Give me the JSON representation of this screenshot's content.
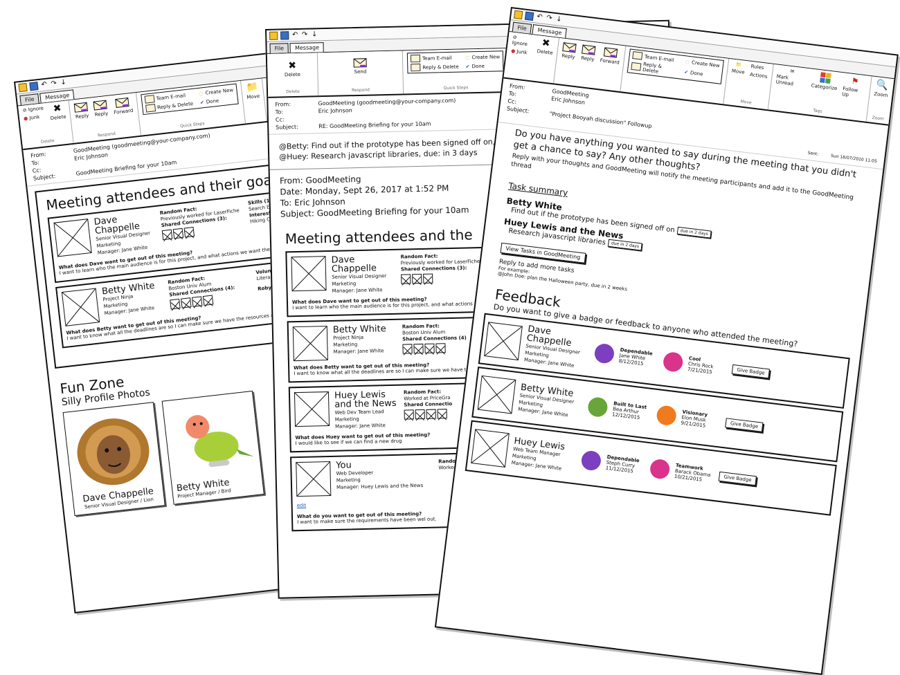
{
  "left": {
    "tabs": [
      "File",
      "Message"
    ],
    "ribbon": {
      "delete_group": {
        "ignore": "Ignore",
        "junk": "Junk",
        "delete": "Delete",
        "caption": "Delete"
      },
      "respond_group": {
        "reply": "Reply",
        "reply_all": "Reply",
        "forward": "Forward",
        "caption": "Respond"
      },
      "quick_steps": {
        "team_email": "Team E-mail",
        "create_new": "Create New",
        "reply_delete": "Reply & Delete",
        "done": "Done",
        "caption": "Quick Steps"
      },
      "move": "Move"
    },
    "header": {
      "from_label": "From:",
      "from": "GoodMeeting (goodmeeting@your-company.com)",
      "to_label": "To:",
      "to": "Eric Johnson",
      "cc_label": "Cc:",
      "subject_label": "Subject:",
      "subject": "GoodMeeting Briefing for your 10am"
    },
    "section_title": "Meeting attendees and their goals",
    "cards": [
      {
        "name_line1": "Dave",
        "name_line2": "Chappelle",
        "title": "Senior Visual Designer",
        "dept": "Marketing",
        "manager": "Manager: Jane White",
        "fact_label": "Random Fact:",
        "fact": "Previously worked for LaserFiche",
        "conn_label": "Shared Connections (3):",
        "skills_label": "Skills (1)",
        "skills": "Search Engine M",
        "interests_label": "Interests (10)",
        "interests": "Hiking   Cars",
        "question": "What does Dave want to get out of this meeting?",
        "answer": "I want to learn who the main audience is for this project, and what actions we want them to take."
      },
      {
        "name_line1": "Betty White",
        "name_line2": "",
        "title": "Project Ninja",
        "dept": "Marketing",
        "manager": "Manager: Jane White",
        "fact_label": "Random Fact:",
        "fact": "Boston Univ Alum",
        "conn_label": "Shared Connections (4):",
        "volunteer_label": "Volunteer",
        "volunteer": "Literacy/P",
        "note": "Robyn ho profile!",
        "question": "What does Betty want to get out of this meeting?",
        "answer": "I want to know what all the deadlines are so I can make sure we have the resources available."
      }
    ],
    "fun_zone": {
      "title": "Fun Zone",
      "subtitle": "Silly Profile Photos",
      "photos": [
        {
          "name": "Dave Chappelle",
          "caption": "Senior Visual Designer / Lion"
        },
        {
          "name": "Betty White",
          "caption": "Project Manager / Bird"
        }
      ]
    }
  },
  "middle": {
    "tabs": [
      "File",
      "Message"
    ],
    "ribbon": {
      "delete": "Delete",
      "delete_caption": "Delete",
      "send": "Send",
      "respond_caption": "Respond",
      "quick_steps": {
        "team_email": "Team E-mail",
        "create_new": "Create New",
        "reply_delete": "Reply & Delete",
        "done": "Done",
        "caption": "Quick Steps"
      }
    },
    "header": {
      "from_label": "From:",
      "from": "GoodMeeting (goodmeeting@your-company.com)",
      "to_label": "To:",
      "to": "Eric Johnson",
      "cc_label": "Cc:",
      "subject_label": "Subject:",
      "subject": "RE: GoodMeeting Briefing for your 10am"
    },
    "mentions": [
      "@Betty: Find out if the prototype has been signed off on, d",
      "@Huey: Research javascript libraries, due: in 3 days"
    ],
    "forwarded": {
      "from": "From: GoodMeeting",
      "date": "Date: Monday, Sept 26, 2017 at 1:52 PM",
      "to": "To: Eric Johnson",
      "subject": "Subject: GoodMeeting Briefing for your 10am"
    },
    "section_title": "Meeting attendees and the",
    "cards": [
      {
        "name_line1": "Dave",
        "name_line2": "Chappelle",
        "title": "Senior Visual Designer",
        "dept": "Marketing",
        "manager": "Manager: Jane White",
        "fact_label": "Random Fact:",
        "fact": "Previously worked for LaserFiche",
        "conn_label": "Shared Connections (3):",
        "question": "What does Dave want to get out of this meeting?",
        "answer": "I want to learn who the main audience is for this project, and what actions we want them to take."
      },
      {
        "name_line1": "Betty White",
        "name_line2": "",
        "title": "Project Ninja",
        "dept": "Marketing",
        "manager": "Manager: Jane White",
        "fact_label": "Random Fact:",
        "fact": "Boston Univ Alum",
        "conn_label": "Shared Connections (4)",
        "question": "What does Betty want to get out of this meeting?",
        "answer": "I want to know what all the deadlines are so I can make sure we have the resources available."
      },
      {
        "name_line1": "Huey Lewis",
        "name_line2": "and the News",
        "title": "Web Dev Team Lead",
        "dept": "Marketing",
        "manager": "Manager: Jane White",
        "fact_label": "Random Fact:",
        "fact": "Worked at PriceGra",
        "conn_label": "Shared Connectio",
        "question": "What does Huey want to get out of this meeting?",
        "answer": "I would like to see if we can find a new drug"
      },
      {
        "name_line1": "You",
        "name_line2": "",
        "title": "Web Developer",
        "dept": "Marketing",
        "manager": "Manager: Huey Lewis and the News",
        "fact_label": "Random Fac",
        "fact": "Worked at A",
        "edit": "edit",
        "question": "What do you want to get out of this meeting?",
        "answer": "I want to make sure the requirements have been wel out."
      }
    ]
  },
  "right": {
    "tabs": [
      "File",
      "Message"
    ],
    "ribbon": {
      "ignore": "Ignore",
      "junk": "Junk",
      "delete": "Delete",
      "reply": "Reply",
      "reply_all": "Reply",
      "forward": "Forward",
      "quick_steps": {
        "team_email": "Team E-mail",
        "create_new": "Create New",
        "reply_delete": "Reply & Delete",
        "done": "Done"
      },
      "move": "Move",
      "rules": "Rules",
      "actions": "Actions",
      "mark_unread": "Mark Unread",
      "categorize": "Categorize",
      "follow_up": "Follow Up",
      "zoom": "Zoom",
      "tags_caption": "Tags",
      "zoom_caption": "Zoom",
      "move_caption": "Move"
    },
    "header": {
      "from_label": "From:",
      "from": "GoodMeeting",
      "to_label": "To:",
      "to": "Eric Johnson",
      "cc_label": "Cc:",
      "subject_label": "Subject:",
      "subject": "\"Project Booyah discussion\" Followup",
      "sent_label": "Sent:",
      "sent": "Sun 18/07/2010 11:05"
    },
    "intro": "Do you have anything you wanted to say during the meeting that you didn't get a chance to say? Any other thoughts?",
    "intro2": "Reply with your thoughts and GoodMeeting will notify the meeting participants and add it to the GoodMeeting thread",
    "task_summary": {
      "title": "Task summary",
      "tasks": [
        {
          "who": "Betty White",
          "what": "Find out if the prototype has been signed off on",
          "due": "due in 2 days"
        },
        {
          "who": "Huey Lewis and the News",
          "what": "Research javascript libraries",
          "due": "due in 2 days"
        }
      ],
      "view_button": "View Tasks in GoodMeeting",
      "reply_hint": "Reply to add more tasks",
      "example_label": "For example:",
      "example": "@John Doe: plan the Halloween party, due in 2 weeks"
    },
    "feedback": {
      "title": "Feedback",
      "question": "Do you want to give a badge or feedback to anyone who attended the meeting?",
      "give_badge": "Give Badge",
      "people": [
        {
          "name": "Dave Chappelle",
          "title": "Senior Visual Designer",
          "dept": "Marketing",
          "manager": "Manager: Jane White",
          "badges": [
            {
              "label": "Dependable",
              "by": "Jane White",
              "date": "8/12/2015",
              "color": "#7b3fbf"
            },
            {
              "label": "Cool",
              "by": "Chris Rock",
              "date": "7/21/2015",
              "color": "#d9338c"
            }
          ]
        },
        {
          "name": "Betty White",
          "title": "Senior Visual Designer",
          "dept": "Marketing",
          "manager": "Manager: Jane White",
          "badges": [
            {
              "label": "Built to Last",
              "by": "Bea Arthur",
              "date": "12/12/2015",
              "color": "#6aa53a"
            },
            {
              "label": "Visionary",
              "by": "Elon Musk",
              "date": "9/21/2015",
              "color": "#f07a1e"
            }
          ]
        },
        {
          "name": "Huey Lewis",
          "title": "Web Team Manager",
          "dept": "Marketing",
          "manager": "Manager: Jane White",
          "badges": [
            {
              "label": "Dependable",
              "by": "Steph Curry",
              "date": "11/12/2015",
              "color": "#7b3fbf"
            },
            {
              "label": "Teamwork",
              "by": "Barack Obama",
              "date": "10/21/2015",
              "color": "#d9338c"
            }
          ]
        }
      ]
    }
  }
}
